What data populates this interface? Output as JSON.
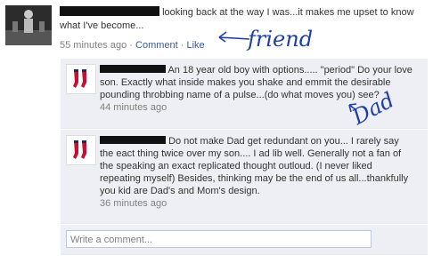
{
  "post": {
    "text": "looking back at the way I was...it makes me upset to know what I've become...",
    "time": "55 minutes ago",
    "separator": "·",
    "comment_label": "Comment",
    "like_label": "Like"
  },
  "comments": [
    {
      "text": "An 18 year old boy with options..... \"period\" Do your love son. Exactly what inside makes you shake and emmit the desirable pounding throbbing name of a pulse...(do what moves you) see?",
      "time": "44 minutes ago"
    },
    {
      "text": "Do not make Dad get redundant on you... I rarely say the eact thing twice over my son.... I ad lib well. Generally not a fan of the speaking an exact replicated thought outloud. (I never liked repeating myself) Besides, thinking may be the end of us all...thankfully you kid are Dad's and Mom's design.",
      "time": "36 minutes ago"
    }
  ],
  "composer": {
    "placeholder": "Write a comment..."
  },
  "annotations": {
    "friend": "friend",
    "dad": "Dad"
  },
  "colors": {
    "link": "#3b5998",
    "comment_bg": "#edeff4",
    "handwriting": "#1f3fa8"
  }
}
